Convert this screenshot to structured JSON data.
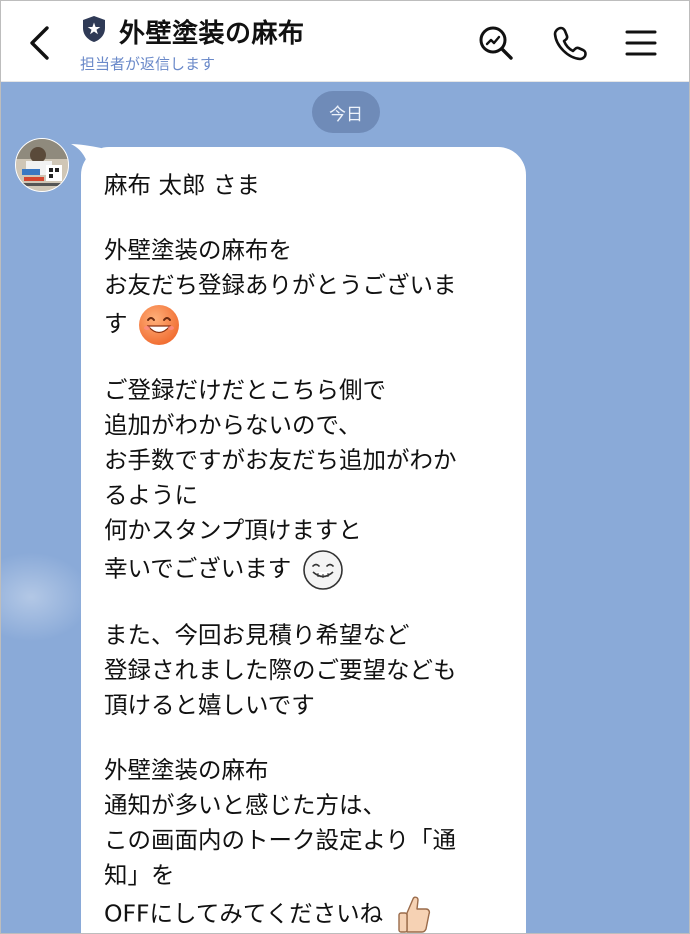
{
  "header": {
    "back_icon": "chevron-left-icon",
    "badge_icon": "shield-star-icon",
    "title": "外壁塗装の麻布",
    "subtitle": "担当者が返信します",
    "search_icon": "search-icon",
    "call_icon": "phone-icon",
    "menu_icon": "menu-icon"
  },
  "chat": {
    "date_label": "今日",
    "background_color": "#8aaad8",
    "message": {
      "greeting": "麻布 太郎 さま",
      "p1_l1": "外壁塗装の麻布を",
      "p1_l2": "お友だち登録ありがとうございま",
      "p1_l3": "す",
      "p1_emoji": "smiling-face-emoji",
      "p2_l1": "ご登録だけだとこちら側で",
      "p2_l2": "追加がわからないので、",
      "p2_l3": "お手数ですがお友だち追加がわか",
      "p2_l4": "るように",
      "p2_l5": "何かスタンプ頂けますと",
      "p2_l6": "幸いでございます",
      "p2_emoji": "grinning-face-emoji",
      "p3_l1": "また、今回お見積り希望など",
      "p3_l2": "登録されました際のご要望なども",
      "p3_l3": "頂けると嬉しいです",
      "p4_l1": "外壁塗装の麻布",
      "p4_l2": "通知が多いと感じた方は、",
      "p4_l3": "この画面内のトーク設定より「通",
      "p4_l4": "知」を",
      "p4_l5": "OFFにしてみてくださいね",
      "p4_emoji": "thumbs-up-emoji"
    }
  }
}
